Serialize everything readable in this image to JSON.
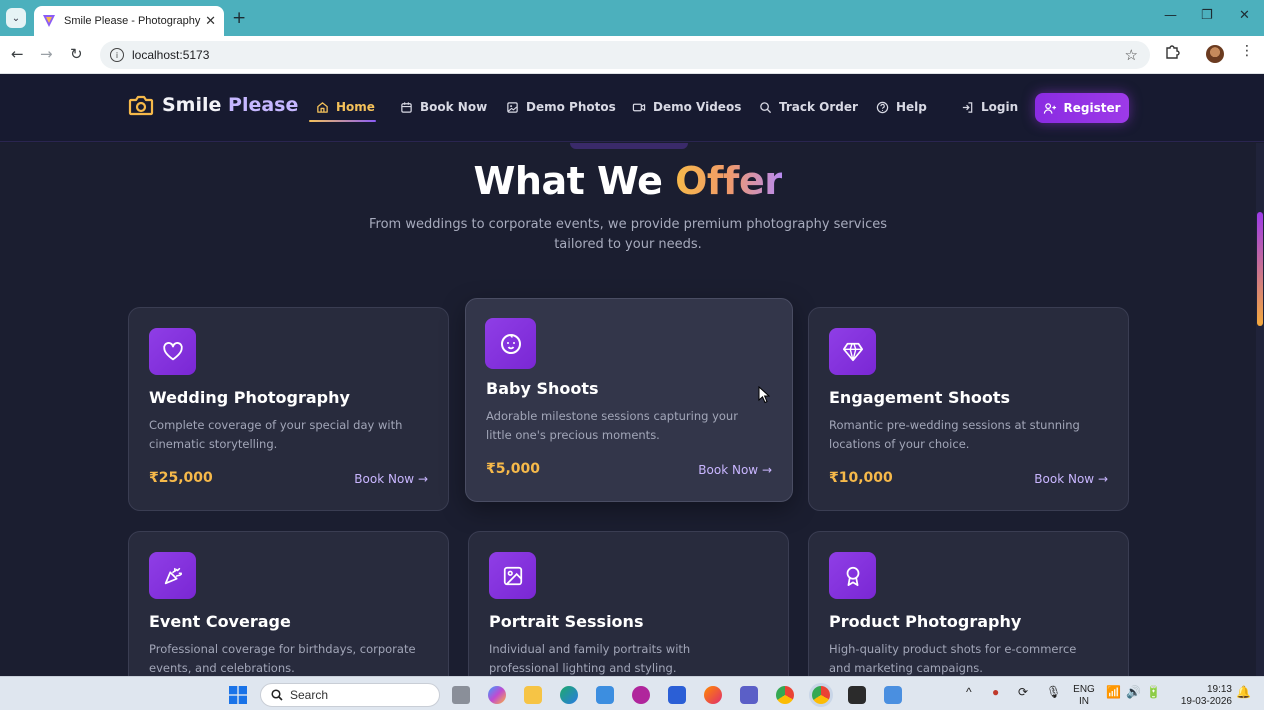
{
  "browser": {
    "tab_title": "Smile Please - Photography Services",
    "new_tab": "+",
    "close_tab": "✕",
    "url": "localhost:5173",
    "window_controls": {
      "minimize": "—",
      "maximize": "❐",
      "close": "✕"
    }
  },
  "site": {
    "brand": {
      "word1": "Smile",
      "word2": "Please",
      "logo_icon": "camera-icon"
    },
    "nav": [
      {
        "label": "Home",
        "icon": "home-icon",
        "active": true
      },
      {
        "label": "Book Now",
        "icon": "calendar-icon"
      },
      {
        "label": "Demo Photos",
        "icon": "image-icon"
      },
      {
        "label": "Demo Videos",
        "icon": "video-icon"
      },
      {
        "label": "Track Order",
        "icon": "search-icon"
      },
      {
        "label": "Help",
        "icon": "help-circle-icon"
      },
      {
        "label": "Login",
        "icon": "login-icon"
      }
    ],
    "register_label": "Register",
    "colors": {
      "accent_gold": "#f6b94a",
      "accent_purple": "#8a2be2",
      "bg": "#1b1e30"
    }
  },
  "section": {
    "title_main": "What We",
    "title_accent": "Offer",
    "subtitle": "From weddings to corporate events, we provide premium photography services tailored to your needs."
  },
  "services": [
    {
      "title": "Wedding Photography",
      "desc": "Complete coverage of your special day with cinematic storytelling.",
      "price": "₹25,000",
      "book": "Book Now",
      "icon": "heart-icon"
    },
    {
      "title": "Baby Shoots",
      "desc": "Adorable milestone sessions capturing your little one's precious moments.",
      "price": "₹5,000",
      "book": "Book Now",
      "icon": "baby-icon"
    },
    {
      "title": "Engagement Shoots",
      "desc": "Romantic pre-wedding sessions at stunning locations of your choice.",
      "price": "₹10,000",
      "book": "Book Now",
      "icon": "gem-icon"
    },
    {
      "title": "Event Coverage",
      "desc": "Professional coverage for birthdays, corporate events, and celebrations.",
      "icon": "party-popper-icon"
    },
    {
      "title": "Portrait Sessions",
      "desc": "Individual and family portraits with professional lighting and styling.",
      "icon": "image-icon"
    },
    {
      "title": "Product Photography",
      "desc": "High-quality product shots for e-commerce and marketing campaigns.",
      "icon": "award-icon"
    }
  ],
  "taskbar": {
    "search_placeholder": "Search",
    "lang_line1": "ENG",
    "lang_line2": "IN",
    "time": "19:13",
    "date": "19-03-2026"
  }
}
